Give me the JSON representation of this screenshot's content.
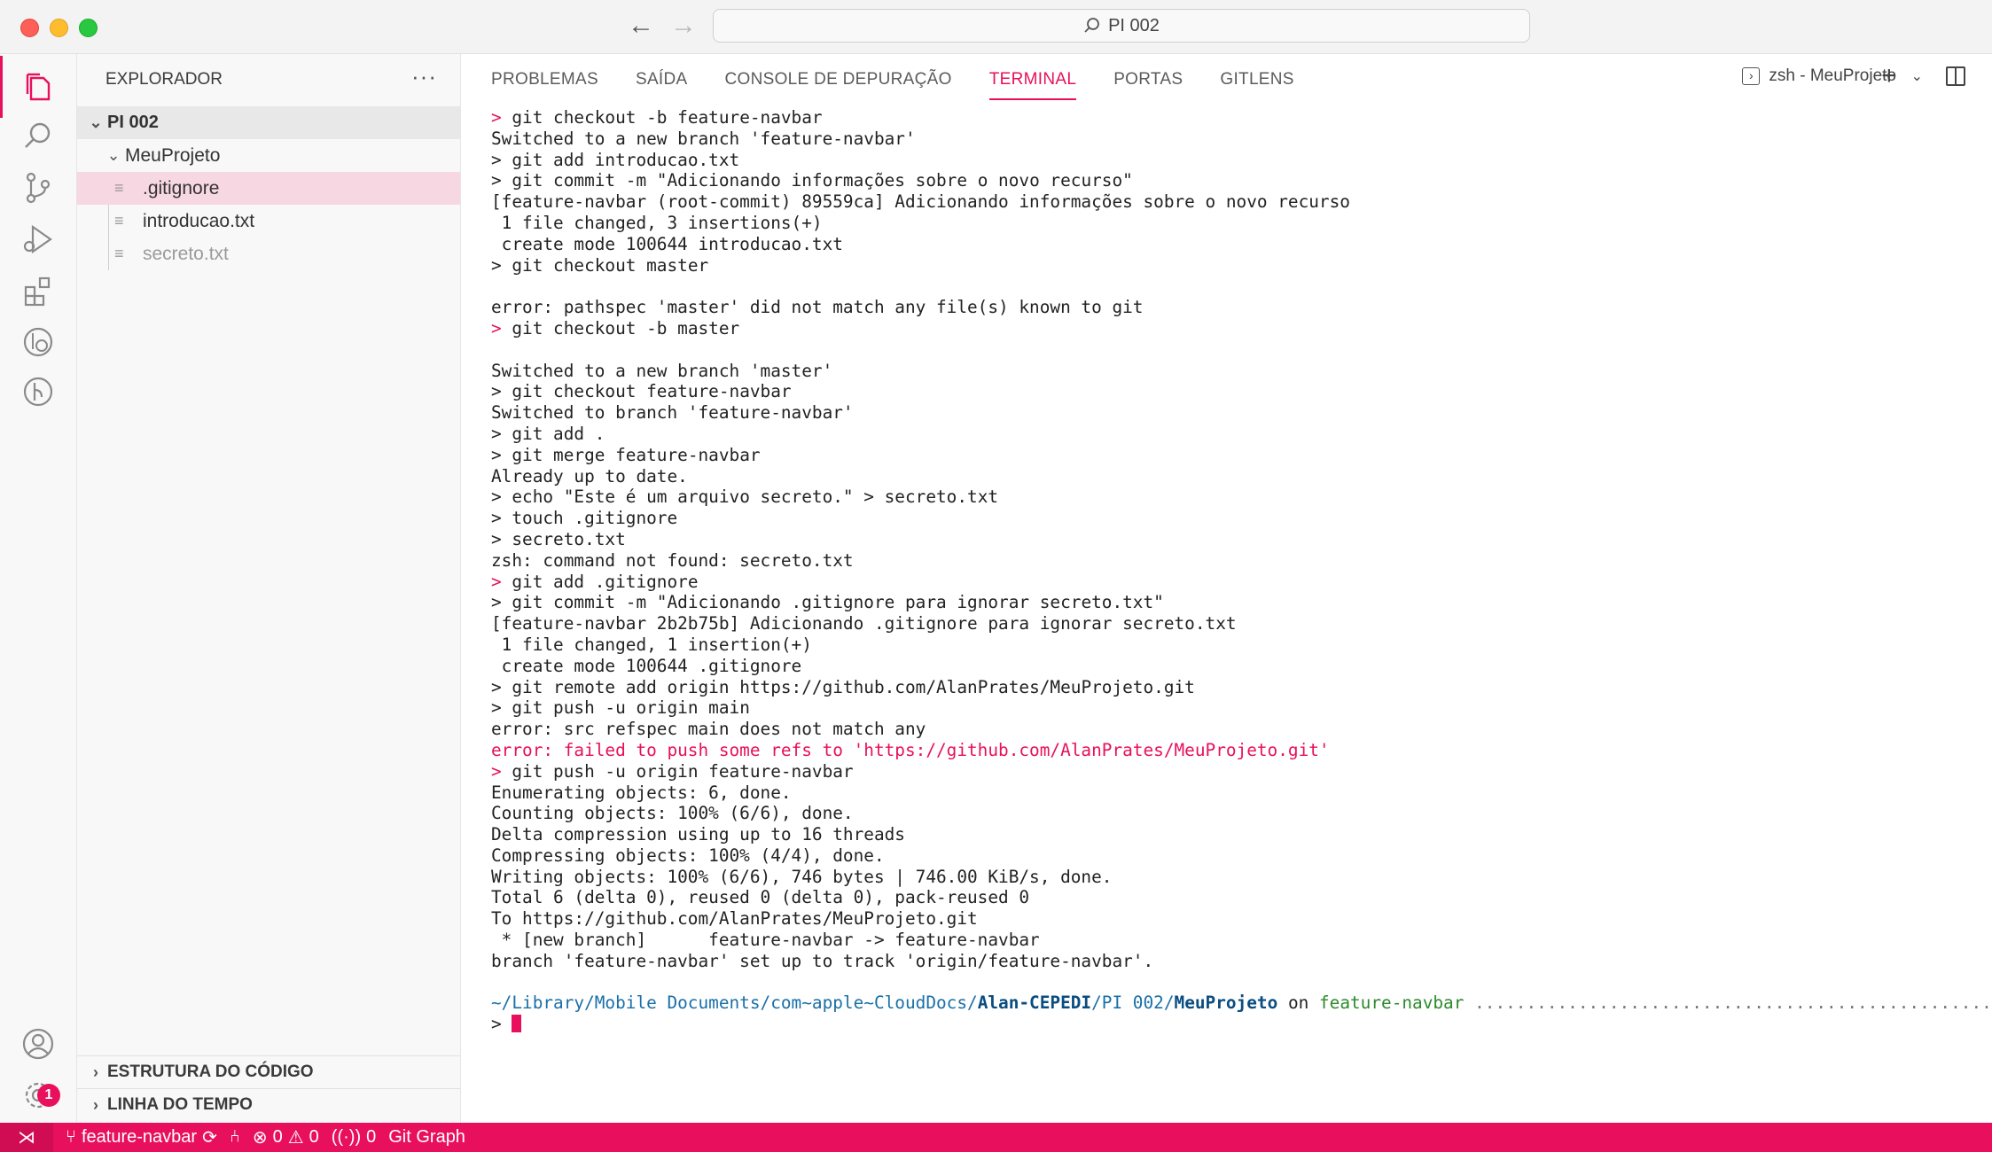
{
  "window": {
    "search_text": "PI 002"
  },
  "sidebar": {
    "title": "EXPLORADOR",
    "more": "···",
    "root": "PI 002",
    "folder": "MeuProjeto",
    "files": [
      ".gitignore",
      "introducao.txt",
      "secreto.txt"
    ],
    "sections": [
      "ESTRUTURA DO CÓDIGO",
      "LINHA DO TEMPO"
    ]
  },
  "activity": {
    "settings_badge": "1"
  },
  "panel": {
    "tabs": [
      "PROBLEMAS",
      "SAÍDA",
      "CONSOLE DE DEPURAÇÃO",
      "TERMINAL",
      "PORTAS",
      "GITLENS"
    ],
    "active_tab": "TERMINAL",
    "terminal_name": "zsh - MeuProjeto"
  },
  "terminal": {
    "lines": [
      {
        "kind": "cmd-err",
        "text": "git checkout -b feature-navbar"
      },
      {
        "kind": "out",
        "text": "Switched to a new branch 'feature-navbar'"
      },
      {
        "kind": "cmd",
        "text": "git add introducao.txt"
      },
      {
        "kind": "cmd",
        "text": "git commit -m \"Adicionando informações sobre o novo recurso\""
      },
      {
        "kind": "out",
        "text": "[feature-navbar (root-commit) 89559ca] Adicionando informações sobre o novo recurso"
      },
      {
        "kind": "out",
        "text": " 1 file changed, 3 insertions(+)"
      },
      {
        "kind": "out",
        "text": " create mode 100644 introducao.txt"
      },
      {
        "kind": "cmd",
        "text": "git checkout master"
      },
      {
        "kind": "blank",
        "text": ""
      },
      {
        "kind": "out",
        "text": "error: pathspec 'master' did not match any file(s) known to git"
      },
      {
        "kind": "cmd-err",
        "text": "git checkout -b master"
      },
      {
        "kind": "blank",
        "text": ""
      },
      {
        "kind": "out",
        "text": "Switched to a new branch 'master'"
      },
      {
        "kind": "cmd",
        "text": "git checkout feature-navbar"
      },
      {
        "kind": "out",
        "text": "Switched to branch 'feature-navbar'"
      },
      {
        "kind": "cmd",
        "text": "git add ."
      },
      {
        "kind": "cmd",
        "text": "git merge feature-navbar"
      },
      {
        "kind": "out",
        "text": "Already up to date."
      },
      {
        "kind": "cmd",
        "text": "echo \"Este é um arquivo secreto.\" > secreto.txt"
      },
      {
        "kind": "cmd",
        "text": "touch .gitignore"
      },
      {
        "kind": "cmd",
        "text": "secreto.txt"
      },
      {
        "kind": "out",
        "text": "zsh: command not found: secreto.txt"
      },
      {
        "kind": "cmd-err",
        "text": "git add .gitignore"
      },
      {
        "kind": "cmd",
        "text": "git commit -m \"Adicionando .gitignore para ignorar secreto.txt\""
      },
      {
        "kind": "out",
        "text": "[feature-navbar 2b2b75b] Adicionando .gitignore para ignorar secreto.txt"
      },
      {
        "kind": "out",
        "text": " 1 file changed, 1 insertion(+)"
      },
      {
        "kind": "out",
        "text": " create mode 100644 .gitignore"
      },
      {
        "kind": "cmd",
        "text": "git remote add origin https://github.com/AlanPrates/MeuProjeto.git"
      },
      {
        "kind": "cmd",
        "text": "git push -u origin main"
      },
      {
        "kind": "out",
        "text": "error: src refspec main does not match any"
      },
      {
        "kind": "err",
        "text": "error: failed to push some refs to 'https://github.com/AlanPrates/MeuProjeto.git'"
      },
      {
        "kind": "cmd-err",
        "text": "git push -u origin feature-navbar"
      },
      {
        "kind": "out",
        "text": "Enumerating objects: 6, done."
      },
      {
        "kind": "out",
        "text": "Counting objects: 100% (6/6), done."
      },
      {
        "kind": "out",
        "text": "Delta compression using up to 16 threads"
      },
      {
        "kind": "out",
        "text": "Compressing objects: 100% (4/4), done."
      },
      {
        "kind": "out",
        "text": "Writing objects: 100% (6/6), 746 bytes | 746.00 KiB/s, done."
      },
      {
        "kind": "out",
        "text": "Total 6 (delta 0), reused 0 (delta 0), pack-reused 0"
      },
      {
        "kind": "out",
        "text": "To https://github.com/AlanPrates/MeuProjeto.git"
      },
      {
        "kind": "out",
        "text": " * [new branch]      feature-navbar -> feature-navbar"
      },
      {
        "kind": "out",
        "text": "branch 'feature-navbar' set up to track 'origin/feature-navbar'."
      },
      {
        "kind": "blank",
        "text": ""
      }
    ],
    "prompt": {
      "path_prefix": "~/Library/Mobile Documents/com~apple~CloudDocs/",
      "path_bold1": "Alan-CEPEDI",
      "path_mid": "/PI 002/",
      "path_bold2": "MeuProjeto",
      "on": " on ",
      "branch": "feature-navbar",
      "dots": " .................................................. % a"
    },
    "prompt_symbol": ">"
  },
  "statusbar": {
    "branch": "feature-navbar",
    "errors": "0",
    "warnings": "0",
    "ports": "0",
    "git_graph": "Git Graph"
  },
  "colors": {
    "accent": "#e8105c",
    "selection": "#f7d7e2"
  }
}
